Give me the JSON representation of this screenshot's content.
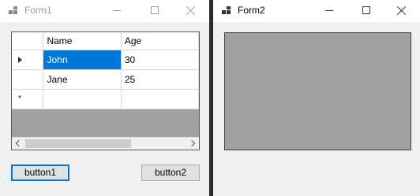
{
  "form1": {
    "title": "Form1",
    "grid": {
      "columns": [
        "Name",
        "Age"
      ],
      "rows": [
        {
          "name": "John",
          "age": "30"
        },
        {
          "name": "Jane",
          "age": "25"
        },
        {
          "name": "",
          "age": ""
        }
      ],
      "current_row_marker": "arrow-right-icon",
      "new_row_marker": "*"
    },
    "buttons": {
      "button1": "button1",
      "button2": "button2"
    }
  },
  "form2": {
    "title": "Form2"
  },
  "colors": {
    "selection": "#0078d7",
    "grid_background": "#a0a0a0",
    "window": "#f0f0f0"
  }
}
